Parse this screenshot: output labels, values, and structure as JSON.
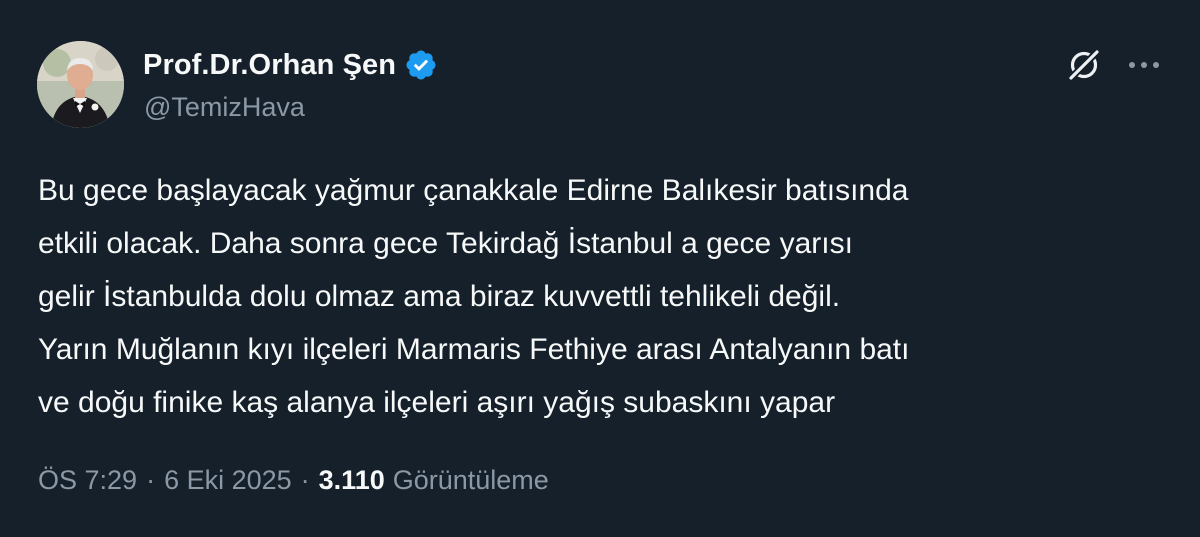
{
  "author": {
    "display_name": "Prof.Dr.Orhan Şen",
    "handle": "@TemizHava",
    "verified_icon": "verified-badge-icon",
    "avatar_alt": "profile photo"
  },
  "actions": {
    "grok_icon": "grok-icon",
    "more_icon": "more-horizontal-icon"
  },
  "tweet": {
    "lines": [
      "Bu gece başlayacak yağmur çanakkale Edirne Balıkesir batısında",
      "etkili olacak. Daha sonra gece Tekirdağ İstanbul a gece yarısı",
      "gelir İstanbulda dolu olmaz ama biraz kuvvettli tehlikeli değil.",
      "Yarın Muğlanın kıyı ilçeleri Marmaris Fethiye arası Antalyanın batı",
      "ve doğu finike kaş alanya ilçeleri aşırı yağış subaskını yapar"
    ]
  },
  "meta": {
    "time": "ÖS 7:29",
    "separator": "·",
    "date": "6 Eki 2025",
    "views_count": "3.110",
    "views_label": "Görüntüleme"
  },
  "colors": {
    "background": "#15202b",
    "text_primary": "#f7f9f9",
    "text_secondary": "#8b98a5",
    "verified_blue": "#1d9bf0"
  }
}
